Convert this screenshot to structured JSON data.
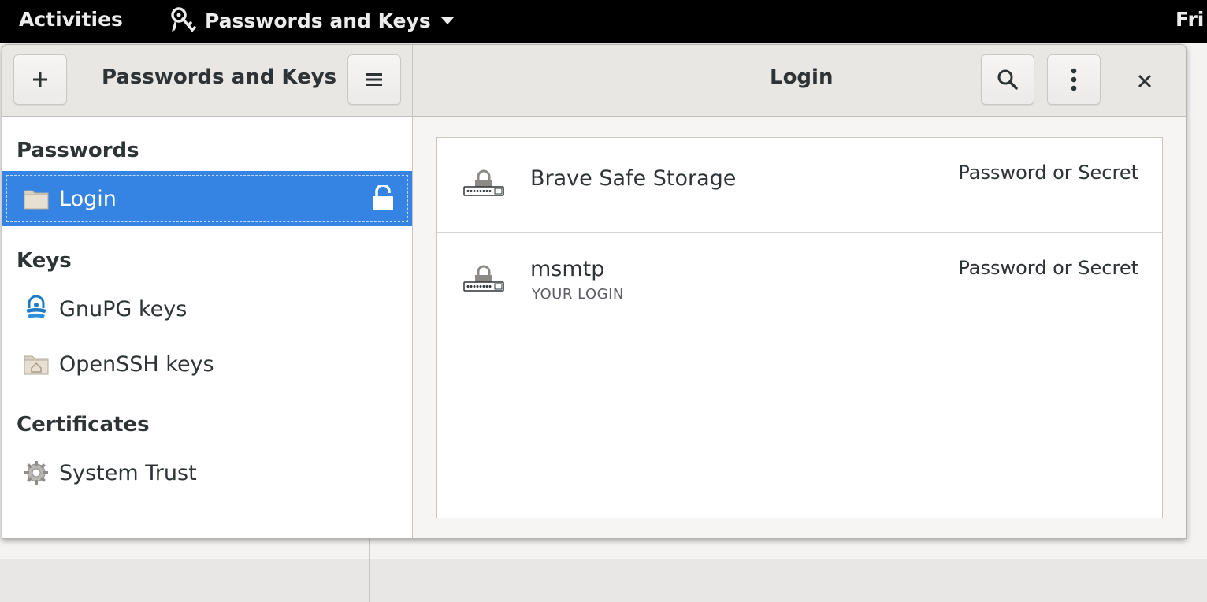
{
  "topbar": {
    "activities": "Activities",
    "app_name": "Passwords and Keys",
    "clock_partial": "Fri"
  },
  "headerbar": {
    "sidebar_title": "Passwords and Keys",
    "content_title": "Login",
    "add_icon": "plus-icon",
    "menu_icon": "hamburger-icon",
    "search_icon": "search-icon",
    "more_icon": "vertical-dots-icon",
    "close_icon": "close-icon"
  },
  "sidebar": {
    "sections": [
      {
        "title": "Passwords",
        "items": [
          {
            "label": "Login",
            "icon": "folder-icon",
            "selected": true,
            "lock_icon": "unlocked-padlock-icon"
          }
        ]
      },
      {
        "title": "Keys",
        "items": [
          {
            "label": "GnuPG keys",
            "icon": "gnupg-icon"
          },
          {
            "label": "OpenSSH keys",
            "icon": "home-folder-icon"
          }
        ]
      },
      {
        "title": "Certificates",
        "items": [
          {
            "label": "System Trust",
            "icon": "gear-icon"
          }
        ]
      }
    ]
  },
  "items": [
    {
      "name": "Brave Safe Storage",
      "subtitle": "",
      "type": "Password or Secret",
      "icon": "password-key-icon"
    },
    {
      "name": "msmtp",
      "subtitle": "YOUR LOGIN",
      "type": "Password or Secret",
      "icon": "password-key-icon"
    }
  ],
  "colors": {
    "selection": "#3584e4",
    "headerbar": "#e9e7e4",
    "topbar": "#000000"
  }
}
